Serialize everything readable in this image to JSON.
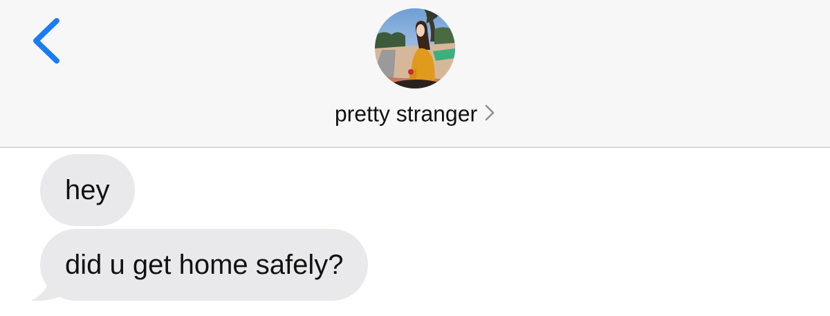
{
  "header": {
    "contact_name": "pretty stranger",
    "avatar_icon": "contact-photo-icon",
    "back_icon": "chevron-left-icon",
    "name_chevron_icon": "chevron-right-icon"
  },
  "messages": [
    {
      "direction": "incoming",
      "text": "hey"
    },
    {
      "direction": "incoming",
      "text": "did u get home safely?"
    }
  ],
  "colors": {
    "accent": "#1a7cf5",
    "header_background": "#f7f7f7",
    "incoming_bubble": "#e9e9eb",
    "text": "#111111"
  }
}
